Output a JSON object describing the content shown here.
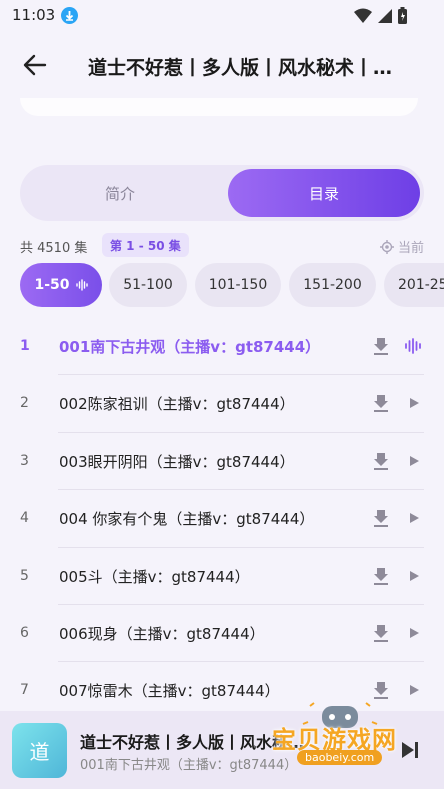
{
  "status_bar": {
    "time": "11:03"
  },
  "header": {
    "title": "道士不好惹丨多人版丨风水秘术丨…"
  },
  "tabs": {
    "intro": "简介",
    "catalog": "目录"
  },
  "episodes_info": {
    "total": "共 4510 集",
    "current_range": "第 1 - 50 集",
    "locate_label": "当前"
  },
  "range_chips": [
    {
      "label": "1-50",
      "active": true
    },
    {
      "label": "51-100"
    },
    {
      "label": "101-150"
    },
    {
      "label": "151-200"
    },
    {
      "label": "201-25"
    }
  ],
  "episodes": [
    {
      "num": "1",
      "title": "001南下古井观（主播v：gt87444）",
      "playing": true
    },
    {
      "num": "2",
      "title": "002陈家祖训（主播v：gt87444）"
    },
    {
      "num": "3",
      "title": "003眼开阴阳（主播v：gt87444）"
    },
    {
      "num": "4",
      "title": "004 你家有个鬼（主播v：gt87444）"
    },
    {
      "num": "5",
      "title": "005斗（主播v：gt87444）"
    },
    {
      "num": "6",
      "title": "006现身（主播v：gt87444）"
    },
    {
      "num": "7",
      "title": "007惊雷木（主播v：gt87444）"
    }
  ],
  "player": {
    "cover_text": "道",
    "title": "道士不好惹丨多人版丨风水秘…",
    "subtitle": "001南下古井观（主播v：gt87444）"
  },
  "watermark": {
    "text": "宝贝游戏网",
    "url": "baobeiy.com"
  },
  "colors": {
    "accent": "#8b5cf0",
    "accent_dark": "#6e3fe6",
    "background": "#f5f3fb"
  }
}
